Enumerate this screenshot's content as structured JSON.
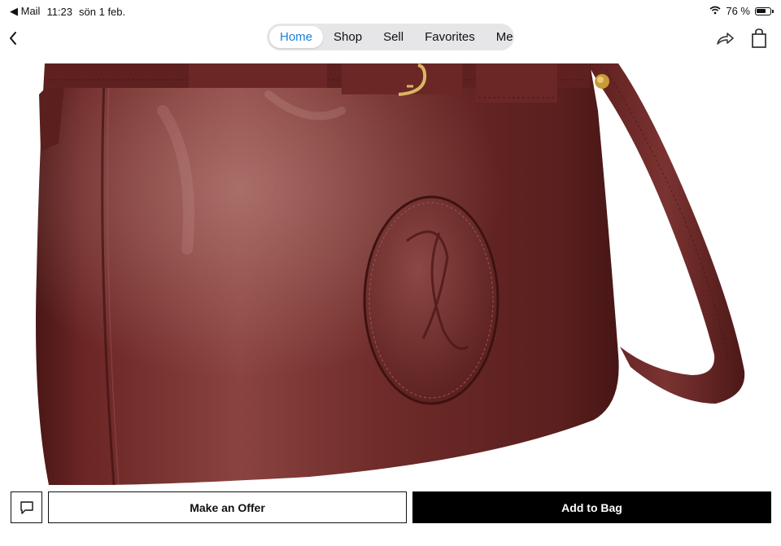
{
  "status_bar": {
    "back_app": "◀ Mail",
    "time": "11:23",
    "date": "sön 1 feb.",
    "battery": "76 %",
    "battery_level": 0.76
  },
  "nav": {
    "tabs": [
      {
        "label": "Home",
        "active": true
      },
      {
        "label": "Shop",
        "active": false
      },
      {
        "label": "Sell",
        "active": false
      },
      {
        "label": "Favorites",
        "active": false
      },
      {
        "label": "Me",
        "active": false
      }
    ],
    "accent_color": "#1a7fd6"
  },
  "product": {
    "image": "burgundy leather handbag with shoulder strap",
    "leather_color": "#6e2a2a"
  },
  "actions": {
    "make_offer": "Make an Offer",
    "add_to_bag": "Add to Bag"
  },
  "icons": [
    "chevron-left-icon",
    "share-icon",
    "shopping-bag-icon",
    "chat-icon",
    "wifi-icon",
    "battery-icon"
  ]
}
